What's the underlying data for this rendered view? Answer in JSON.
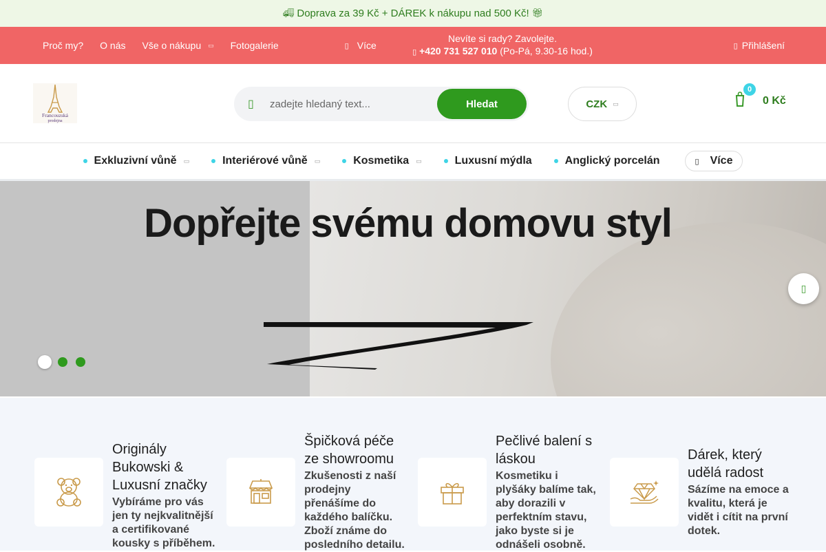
{
  "promo": {
    "text": "Doprava za 39 Kč + DÁREK k nákupu nad 500 Kč!"
  },
  "topnav": {
    "items": [
      "Proč my?",
      "O nás",
      "Vše o nákupu",
      "Fotogalerie"
    ],
    "more_label": "Více",
    "help_line": "Nevíte si rady? Zavolejte.",
    "phone": "+420 731 527 010",
    "phone_hours": "(Po-Pá, 9.30-16 hod.)",
    "login_label": "Přihlášení"
  },
  "header": {
    "logo_text_1": "Francouzská",
    "logo_text_2": "prodejna",
    "search_placeholder": "zadejte hledaný text...",
    "search_button": "Hledat",
    "currency": "CZK",
    "cart_count": "0",
    "cart_amount": "0 Kč"
  },
  "categories": {
    "items": [
      "Exkluzivní vůně",
      "Interiérové vůně",
      "Kosmetika",
      "Luxusní mýdla",
      "Anglický porcelán"
    ],
    "more_label": "Více"
  },
  "hero": {
    "title": "Dopřejte svému domovu styl",
    "slides": 3,
    "active_slide": 1
  },
  "features": [
    {
      "title": "Originály Bukowski & Luxusní značky",
      "text": "Vybíráme pro vás jen ty nejkvalitnější a certifikované kousky s příběhem.",
      "icon": "teddy-bear-icon"
    },
    {
      "title": "Špičková péče ze showroomu",
      "text": "Zkušenosti z naší prodejny přenášíme do každého balíčku. Zboží známe do posledního detailu.",
      "icon": "shop-icon"
    },
    {
      "title": "Pečlivé balení s láskou",
      "text": "Kosmetiku i plyšáky balíme tak, aby dorazili v perfektním stavu, jako byste si je odnášeli osobně.",
      "icon": "gift-icon"
    },
    {
      "title": "Dárek, který udělá radost",
      "text": "Sázíme na emoce a kvalitu, která je vidět i cítit na první dotek.",
      "icon": "diamond-hand-icon"
    }
  ],
  "colors": {
    "accent_green": "#2f9a1e",
    "red_bar": "#f06565",
    "badge_cyan": "#3ed4e6"
  }
}
